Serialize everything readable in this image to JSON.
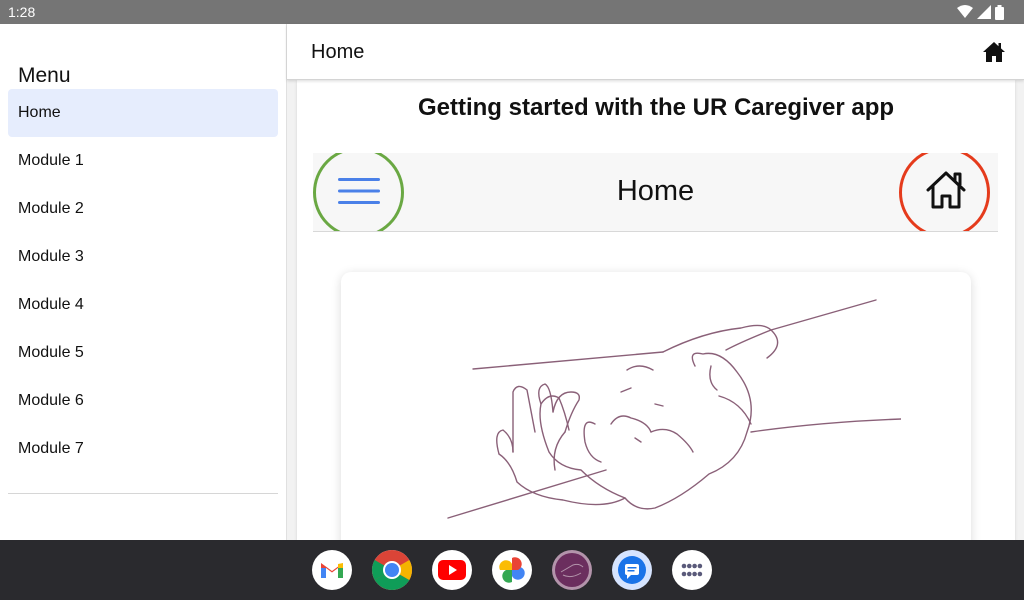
{
  "status_bar": {
    "time": "1:28",
    "icons": [
      "wifi-icon",
      "signal-icon",
      "battery-icon"
    ]
  },
  "drawer": {
    "title": "Menu",
    "items": [
      {
        "label": "Home",
        "active": true
      },
      {
        "label": "Module 1"
      },
      {
        "label": "Module 2"
      },
      {
        "label": "Module 3"
      },
      {
        "label": "Module 4"
      },
      {
        "label": "Module 5"
      },
      {
        "label": "Module 6"
      },
      {
        "label": "Module 7"
      }
    ]
  },
  "header": {
    "title": "Home",
    "action_icon": "home-icon"
  },
  "content": {
    "heading": "Getting started with the UR Caregiver app",
    "demo_toolbar": {
      "title": "Home",
      "left_icon": "hamburger-menu-icon",
      "right_icon": "home-outline-icon",
      "left_highlight_color": "#6aa843",
      "right_highlight_color": "#e53b1c"
    },
    "illustration": "handshake-illustration"
  },
  "taskbar": {
    "apps": [
      "gmail-icon",
      "chrome-icon",
      "youtube-icon",
      "photos-icon",
      "caregiver-app-icon",
      "messages-icon",
      "app-drawer-icon"
    ]
  },
  "colors": {
    "accent": "#4a80e8",
    "active_nav_bg": "#e6edfd",
    "status_bar": "#757575",
    "taskbar": "#2a2a2e"
  }
}
